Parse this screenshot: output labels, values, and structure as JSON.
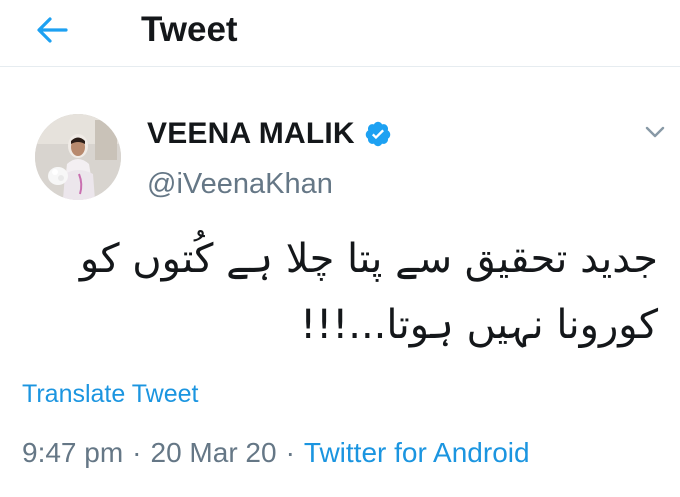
{
  "header": {
    "title": "Tweet",
    "back_icon": "arrow-left-icon",
    "accent_color": "#1da1f2"
  },
  "author": {
    "display_name": "VEENA MALIK",
    "handle": "@iVeenaKhan",
    "verified": true,
    "verified_icon": "verified-badge-icon",
    "avatar_icon": "profile-photo"
  },
  "menu": {
    "icon": "chevron-down-icon"
  },
  "tweet": {
    "text": "جدید تحقیق سے پتا چلا ہے کُتوں کو\nکورونا نہیں ہوتا...!!!"
  },
  "translate_label": "Translate Tweet",
  "meta": {
    "time": "9:47 pm",
    "separator": "·",
    "date": "20 Mar 20",
    "source": "Twitter for Android"
  },
  "colors": {
    "link": "#1b95e0",
    "secondary_text": "#657786",
    "primary_text": "#14171a",
    "divider": "#e6ecf0"
  }
}
